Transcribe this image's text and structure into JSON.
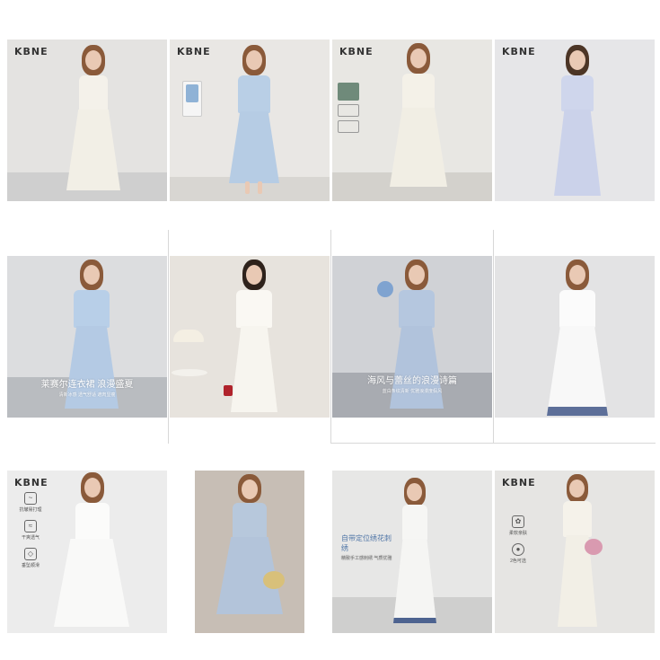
{
  "brand": "KBNE",
  "tiles": [
    {
      "brand": "KBNE"
    },
    {
      "brand": "KBNE"
    },
    {
      "brand": "KBNE"
    },
    {
      "brand": "KBNE"
    },
    {
      "caption_main": "莱赛尔连衣裙 浪漫盛夏",
      "caption_sub": "清新冰感 透气舒适 遮肉显瘦"
    },
    {},
    {
      "caption_main": "海风与蕾丝的浪漫诗篇",
      "caption_sub": "蓝白条纹清新 优雅浪漫度假风"
    },
    {},
    {
      "brand": "KBNE",
      "features": [
        "抗皱易打理",
        "干爽透气",
        "垂坠顺滑"
      ]
    },
    {},
    {
      "caption_main": "自带定位绣花刺绣",
      "caption_sub": "精致手工感刺绣 气质优雅"
    },
    {
      "brand": "KBNE",
      "features": [
        "柔软亲肤",
        "2色可选"
      ]
    }
  ],
  "colors": {
    "bg_light": "#e8e8e8",
    "floor": "#cfcfcf",
    "dress_white": "#f4f1ea",
    "dress_blue": "#bcd0e6",
    "dress_lavender": "#cdd3ea"
  }
}
